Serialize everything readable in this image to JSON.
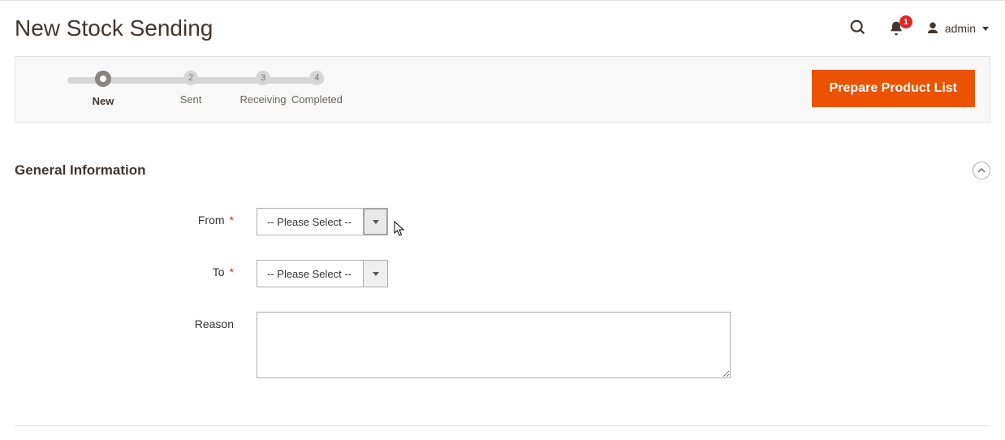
{
  "header": {
    "title": "New Stock Sending",
    "username": "admin",
    "notification_count": "1"
  },
  "steps": {
    "items": [
      {
        "label": "New",
        "num": ""
      },
      {
        "label": "Sent",
        "num": "2"
      },
      {
        "label": "Receiving",
        "num": "3"
      },
      {
        "label": "Completed",
        "num": "4"
      }
    ]
  },
  "actions": {
    "prepare": "Prepare Product List"
  },
  "section": {
    "title": "General Information"
  },
  "form": {
    "from_label": "From",
    "from_value": "-- Please Select --",
    "to_label": "To",
    "to_value": "-- Please Select --",
    "reason_label": "Reason",
    "reason_value": ""
  }
}
